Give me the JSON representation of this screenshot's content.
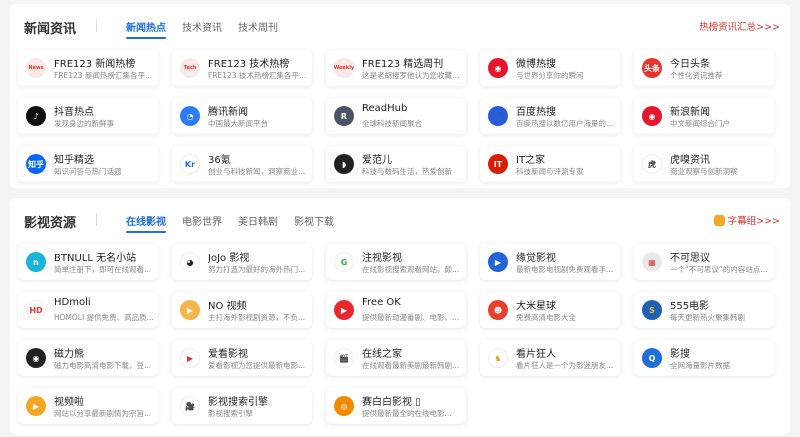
{
  "news": {
    "title": "新闻资讯",
    "tabs": [
      "新闻热点",
      "技术资讯",
      "技术周刊"
    ],
    "more": "热榜资讯汇总>>>",
    "cards": [
      {
        "name": "FRE123 新闻热榜",
        "desc": "FRE123 新闻热榜汇集各平...",
        "icon": "news-logo-icon",
        "mark": "News",
        "color": "#fde8e8",
        "fg": "#e0342f"
      },
      {
        "name": "FRE123 技术热榜",
        "desc": "FRE123 技术热榜汇集各平...",
        "icon": "tech-logo-icon",
        "mark": "Tech",
        "color": "#fde8e8",
        "fg": "#e0342f"
      },
      {
        "name": "FRE123 精选周刊",
        "desc": "这是老胡搜罗他认为您收藏的...",
        "icon": "weekly-logo-icon",
        "mark": "Weekly",
        "color": "#fde8e8",
        "fg": "#e0342f"
      },
      {
        "name": "微博热搜",
        "desc": "与世界分享你的瞬间",
        "icon": "weibo-icon",
        "mark": "◉",
        "color": "#e6162d",
        "fg": "#fff"
      },
      {
        "name": "今日头条",
        "desc": "个性化资讯推荐",
        "icon": "toutiao-icon",
        "mark": "头条",
        "color": "#e8322e",
        "fg": "#fff"
      },
      {
        "name": "抖音热点",
        "desc": "发现身边的新鲜事",
        "icon": "douyin-icon",
        "mark": "♪",
        "color": "#111111",
        "fg": "#fff"
      },
      {
        "name": "腾讯新闻",
        "desc": "中国最大新闻平台",
        "icon": "tencent-news-icon",
        "mark": "◔",
        "color": "#2d7cf6",
        "fg": "#fff"
      },
      {
        "name": "ReadHub",
        "desc": "全球科技新闻聚合",
        "icon": "readhub-icon",
        "mark": "R",
        "color": "#4a5566",
        "fg": "#fff"
      },
      {
        "name": "百度热搜",
        "desc": "百度热搜以数亿用户海量的...",
        "icon": "baidu-icon",
        "mark": "🐾",
        "color": "#2a5bd7",
        "fg": "#fff"
      },
      {
        "name": "新浪新闻",
        "desc": "中文新闻综合门户",
        "icon": "sina-icon",
        "mark": "◉",
        "color": "#e6162d",
        "fg": "#fff"
      },
      {
        "name": "知乎精选",
        "desc": "知识问答与热门话题",
        "icon": "zhihu-icon",
        "mark": "知乎",
        "color": "#0a66f0",
        "fg": "#fff"
      },
      {
        "name": "36氪",
        "desc": "创业与科技新闻，洞察商业...",
        "icon": "36kr-icon",
        "mark": "Kr",
        "color": "#ffffff",
        "fg": "#1b6fe0"
      },
      {
        "name": "爱范儿",
        "desc": "科技与数码生活，热爱创新",
        "icon": "ifanr-icon",
        "mark": "◗",
        "color": "#222222",
        "fg": "#fff"
      },
      {
        "name": "IT之家",
        "desc": "科技新闻与评测专家",
        "icon": "ithome-icon",
        "mark": "IT",
        "color": "#d81e06",
        "fg": "#fff"
      },
      {
        "name": "虎嗅资讯",
        "desc": "商业观察与创新洞察",
        "icon": "huxiu-icon",
        "mark": "虎",
        "color": "#ffffff",
        "fg": "#333"
      }
    ]
  },
  "video": {
    "title": "影视资源",
    "tabs": [
      "在线影视",
      "电影世界",
      "美日韩剧",
      "影视下载"
    ],
    "more": "字幕组>>>",
    "cards": [
      {
        "name": "BTNULL 无名小站",
        "desc": "简单注册下，即可在线观看...",
        "icon": "btnull-icon",
        "mark": "n",
        "color": "#1ab4d6",
        "fg": "#fff"
      },
      {
        "name": "JoJo 影视",
        "desc": "努力打造为最好的海外热门...",
        "icon": "jojo-icon",
        "mark": "◕",
        "color": "#ffffff",
        "fg": "#222"
      },
      {
        "name": "注视影视",
        "desc": "在线影视搜索观看网站，颇...",
        "icon": "zhushi-icon",
        "mark": "G",
        "color": "#ffffff",
        "fg": "#34a853"
      },
      {
        "name": "缘觉影视",
        "desc": "最新电影电视剧免费观看手...",
        "icon": "yuanjue-icon",
        "mark": "▶",
        "color": "#2066d6",
        "fg": "#fff"
      },
      {
        "name": "不可思议",
        "desc": "一个“不可思议”的内容站点...",
        "icon": "bukesiyi-icon",
        "mark": "▦",
        "color": "#e8e8e8",
        "fg": "#e0342f"
      },
      {
        "name": "HDmoli",
        "desc": "HDMOLI 提供免费、高品质...",
        "icon": "hdmoli-icon",
        "mark": "HD",
        "color": "#ffffff",
        "fg": "#e0342f"
      },
      {
        "name": "NO 视频",
        "desc": "主打海外影视剧资源，不负...",
        "icon": "no-video-icon",
        "mark": "▶",
        "color": "#f5b54a",
        "fg": "#fff"
      },
      {
        "name": "Free OK",
        "desc": "提供最新动漫番剧、电影、...",
        "icon": "freeok-icon",
        "mark": "▶",
        "color": "#e8282d",
        "fg": "#fff"
      },
      {
        "name": "大米星球",
        "desc": "免费高清电影大全",
        "icon": "dami-icon",
        "mark": "☻",
        "color": "#e8402d",
        "fg": "#fff"
      },
      {
        "name": "555电影",
        "desc": "每天更新热火聚集韩剧",
        "icon": "555-icon",
        "mark": "S",
        "color": "#1f5fb4",
        "fg": "#f7b731"
      },
      {
        "name": "磁力熊",
        "desc": "磁力电影高清电影下载，豆...",
        "icon": "cilixiong-icon",
        "mark": "◉",
        "color": "#222222",
        "fg": "#fff"
      },
      {
        "name": "爱看影视",
        "desc": "爱看影视为您提供最新电影...",
        "icon": "aikan-icon",
        "mark": "▶",
        "color": "#ffffff",
        "fg": "#e0342f"
      },
      {
        "name": "在线之家",
        "desc": "在线观看最新美剧最新韩剧...",
        "icon": "zxzj-icon",
        "mark": "🎬",
        "color": "#ffffff",
        "fg": "#333"
      },
      {
        "name": "看片狂人",
        "desc": "看片狂人是一个为影迷朋友...",
        "icon": "kpkuang-icon",
        "mark": "♞",
        "color": "#ffffff",
        "fg": "#e0a020"
      },
      {
        "name": "影搜",
        "desc": "全网海量影片数据",
        "icon": "yingsou-icon",
        "mark": "Q",
        "color": "#1e6fd9",
        "fg": "#fff"
      },
      {
        "name": "视频啦",
        "desc": "网站以分享最新剧情为宗旨...",
        "icon": "shipinla-icon",
        "mark": "▶",
        "color": "#f5a623",
        "fg": "#fff"
      },
      {
        "name": "影视搜索引擎",
        "desc": "影视搜索引擎",
        "icon": "ysss-icon",
        "mark": "🎥",
        "color": "#ffffff",
        "fg": "#333"
      },
      {
        "name": "赛白白影视 ▯",
        "desc": "提供最新最全的在线电影...",
        "icon": "saibai-icon",
        "mark": "◎",
        "color": "#f08a00",
        "fg": "#fff"
      }
    ]
  }
}
